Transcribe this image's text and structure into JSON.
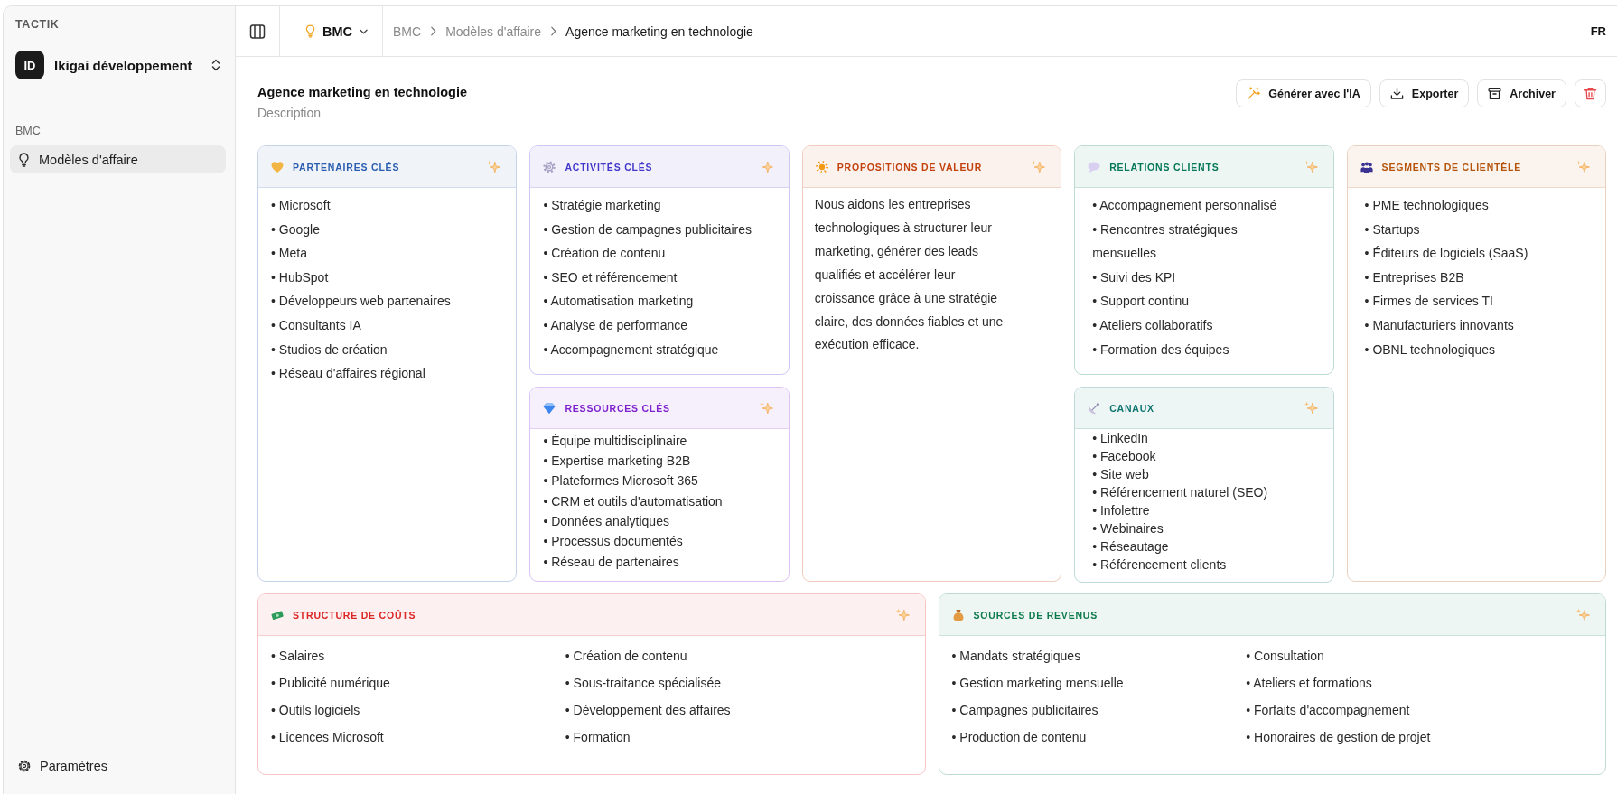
{
  "sidebar": {
    "app_name": "TACTIK",
    "workspace": {
      "initials": "ID",
      "name": "Ikigai développement"
    },
    "sections": [
      {
        "label": "BMC",
        "items": [
          {
            "label": "Modèles d'affaire",
            "selected": true
          }
        ]
      }
    ],
    "footer_items": [
      {
        "label": "Paramètres",
        "selected": false
      }
    ]
  },
  "header": {
    "module": "BMC",
    "breadcrumbs": [
      {
        "label": "BMC",
        "current": false
      },
      {
        "label": "Modèles d'affaire",
        "current": false
      },
      {
        "label": "Agence marketing en technologie",
        "current": true
      }
    ],
    "languages": [
      {
        "label": "FR",
        "selected": true
      }
    ]
  },
  "page": {
    "title": "Agence marketing en technologie",
    "description": "Description",
    "actions": [
      {
        "kind": "ai",
        "label": "Générer avec l'IA"
      },
      {
        "kind": "export",
        "label": "Exporter"
      },
      {
        "kind": "archive",
        "label": "Archiver"
      },
      {
        "kind": "delete"
      }
    ]
  },
  "canvas": {
    "top_columns": [
      {
        "cards": [
          {
            "title": "PARTENAIRES CLÉS",
            "color": "#2a5db0",
            "kind": "list",
            "items": [
              "• Microsoft",
              "• Google",
              "• Meta",
              "• HubSpot",
              "• Développeurs web partenaires",
              "• Consultants IA",
              "• Studios de création",
              "• Réseau d'affaires régional"
            ]
          }
        ]
      },
      {
        "cards": [
          {
            "title": "ACTIVITÉS CLÉS",
            "color": "#4338ca",
            "kind": "list",
            "items": [
              "• Stratégie marketing",
              "• Gestion de campagnes publicitaires",
              "• Création de contenu",
              "• SEO et référencement",
              "• Automatisation marketing",
              "• Analyse de performance",
              "• Accompagnement stratégique"
            ]
          },
          {
            "title": "RESSOURCES CLÉS",
            "color": "#7e22ce",
            "kind": "list",
            "items": [
              "• Équipe multidisciplinaire",
              "• Expertise marketing B2B",
              "• Plateformes Microsoft 365",
              "• CRM et outils d'automatisation",
              "• Données analytiques",
              "• Processus documentés",
              "• Réseau de partenaires"
            ]
          }
        ]
      },
      {
        "cards": [
          {
            "title": "PROPOSITIONS DE VALEUR",
            "color": "#c2410c",
            "kind": "text",
            "text": "Nous aidons les entreprises technologiques à structurer leur marketing, générer des leads qualifiés et accélérer leur croissance grâce à une stratégie claire, des données fiables et une exécution efficace."
          }
        ]
      },
      {
        "cards": [
          {
            "title": "RELATIONS CLIENTS",
            "color": "#047857",
            "kind": "list",
            "items": [
              "• Accompagnement personnalisé",
              "• Rencontres stratégiques mensuelles",
              "• Suivi des KPI",
              "• Support continu",
              "• Ateliers collaboratifs",
              "• Formation des équipes"
            ]
          },
          {
            "title": "CANAUX",
            "color": "#0f766e",
            "kind": "list",
            "items": [
              "• LinkedIn",
              "• Facebook",
              "• Site web",
              "• Référencement naturel (SEO)",
              "• Infolettre",
              "• Webinaires",
              "• Réseautage",
              "• Référencement clients"
            ]
          }
        ]
      },
      {
        "cards": [
          {
            "title": "SEGMENTS DE CLIENTÈLE",
            "color": "#b45309",
            "kind": "list",
            "items": [
              "• PME technologiques",
              "• Startups",
              "• Éditeurs de logiciels (SaaS)",
              "• Entreprises B2B",
              "• Firmes de services TI",
              "• Manufacturiers innovants",
              "• OBNL technologiques"
            ]
          }
        ]
      }
    ],
    "bottom_cards": [
      {
        "title": "STRUCTURE DE COÛTS",
        "color": "#dc2626",
        "kind": "list",
        "items": [
          "• Salaires",
          "• Publicité numérique",
          "• Outils logiciels",
          "• Licences Microsoft",
          "• Création de contenu",
          "• Sous-traitance spécialisée",
          "• Développement des affaires",
          "• Formation"
        ]
      },
      {
        "title": "SOURCES DE REVENUS",
        "color": "#0d7a4e",
        "kind": "list",
        "items": [
          "• Mandats stratégiques",
          "• Gestion marketing mensuelle",
          "• Campagnes publicitaires",
          "• Production de contenu",
          "• Consultation",
          "• Ateliers et formations",
          "• Forfaits d'accompagnement",
          "• Honoraires de gestion de projet"
        ]
      }
    ]
  }
}
